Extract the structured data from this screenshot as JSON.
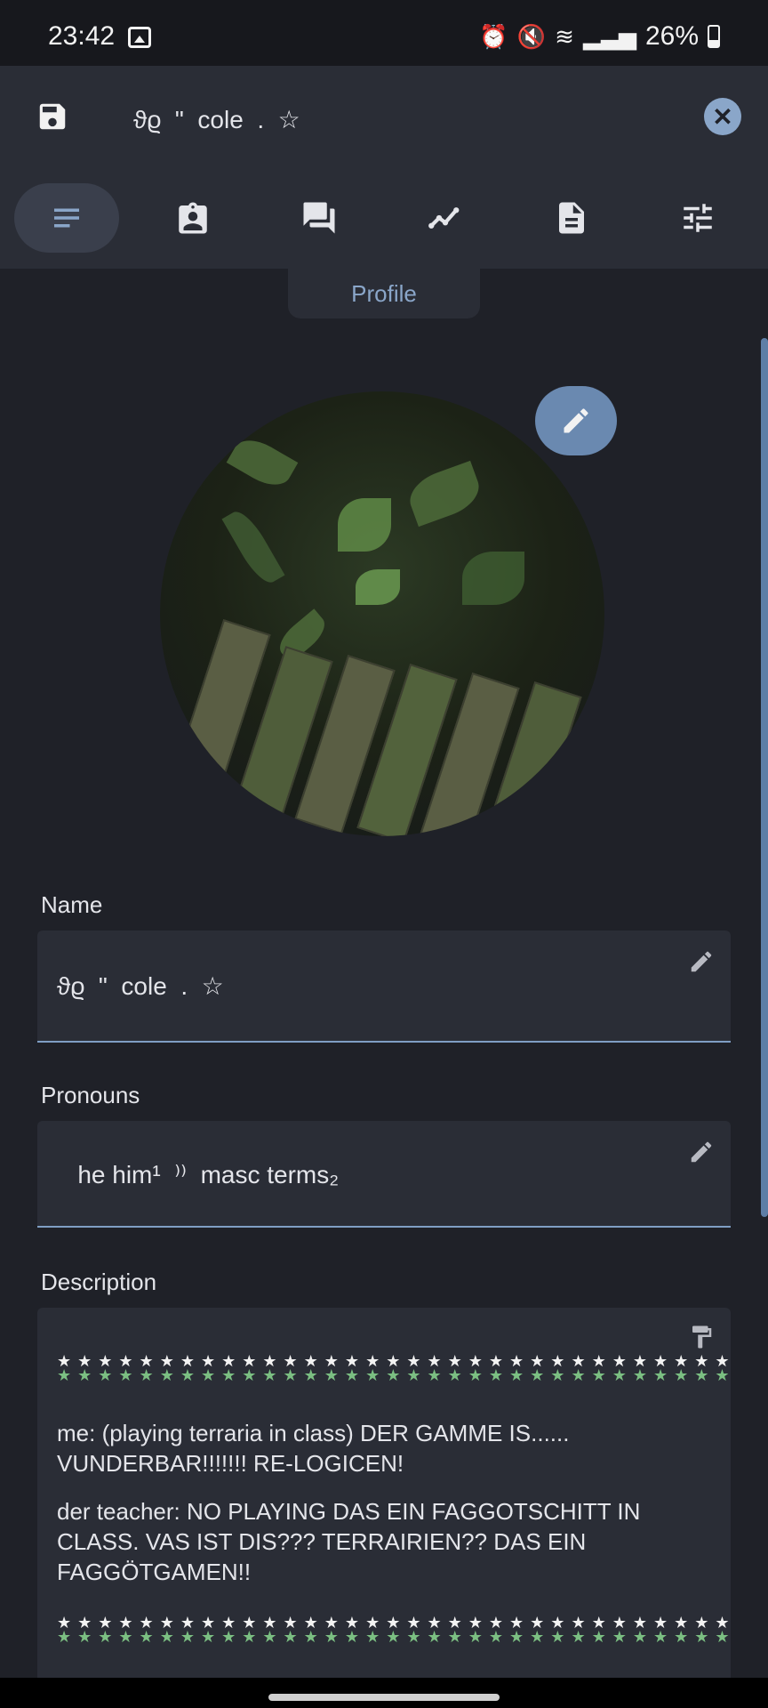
{
  "status_bar": {
    "time": "23:42",
    "battery": "26%"
  },
  "header": {
    "title": "ϑϱ  \"  cole  .  ☆"
  },
  "tabs": [
    {
      "name": "tab-profile",
      "icon": "notes-icon",
      "active": true
    },
    {
      "name": "tab-id",
      "icon": "badge-icon"
    },
    {
      "name": "tab-chat",
      "icon": "chat-icon"
    },
    {
      "name": "tab-stats",
      "icon": "trend-icon"
    },
    {
      "name": "tab-document",
      "icon": "document-icon"
    },
    {
      "name": "tab-settings",
      "icon": "sliders-icon"
    }
  ],
  "tooltip": "Profile",
  "fields": {
    "name_label": "Name",
    "name_value": "ϑϱ  \"  cole  .  ☆",
    "pronouns_label": "Pronouns",
    "pronouns_value": "   he him¹  ⁾⁾  masc terms₂",
    "description_label": "Description"
  },
  "description": {
    "paragraph1": "me: (playing terraria in class) DER GAMME IS...... VUNDERBAR!!!!!!! RE-LOGICEN!",
    "paragraph2": "der teacher: NO PLAYING DAS EIN FAGGOTSCHITT IN CLASS. VAS IST DIS??? TERRAIRIEN?? DAS EIN FAGGÖTGAMEN!!"
  },
  "colors": {
    "accent": "#8aa6c9",
    "background": "#1f2128",
    "surface": "#2a2d36"
  }
}
